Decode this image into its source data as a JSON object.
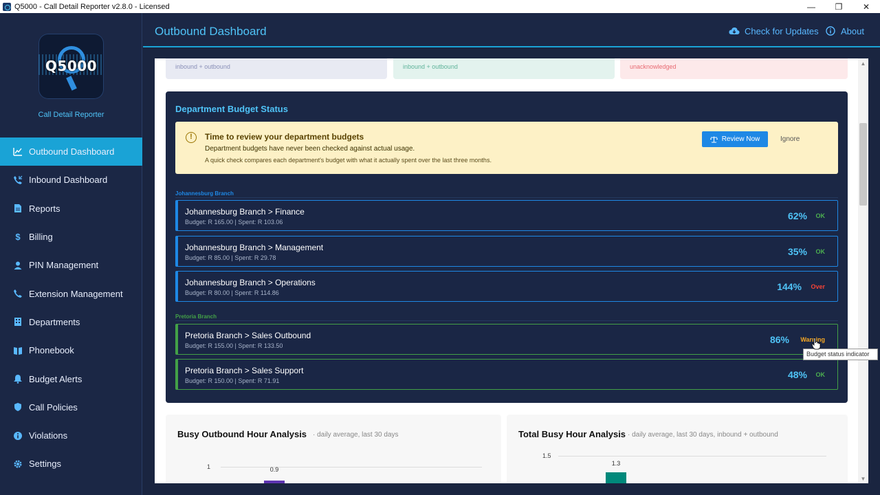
{
  "window": {
    "title": "Q5000 - Call Detail Reporter v2.8.0 - Licensed",
    "minimize": "—",
    "maximize": "❐",
    "close": "✕"
  },
  "sidebar": {
    "logo_text": "Q5000",
    "subtitle": "Call Detail Reporter",
    "items": [
      {
        "label": "Outbound Dashboard",
        "icon": "chart-line-icon",
        "active": true
      },
      {
        "label": "Inbound Dashboard",
        "icon": "phone-incoming-icon"
      },
      {
        "label": "Reports",
        "icon": "document-icon"
      },
      {
        "label": "Billing",
        "icon": "dollar-icon"
      },
      {
        "label": "PIN Management",
        "icon": "user-icon"
      },
      {
        "label": "Extension Management",
        "icon": "phone-icon"
      },
      {
        "label": "Departments",
        "icon": "building-icon"
      },
      {
        "label": "Phonebook",
        "icon": "book-icon"
      },
      {
        "label": "Budget Alerts",
        "icon": "bell-icon"
      },
      {
        "label": "Call Policies",
        "icon": "shield-icon"
      },
      {
        "label": "Violations",
        "icon": "info-icon"
      },
      {
        "label": "Settings",
        "icon": "gear-icon"
      }
    ]
  },
  "header": {
    "title": "Outbound Dashboard",
    "check_updates": "Check for Updates",
    "about": "About"
  },
  "stat_cards": [
    {
      "sub": "inbound + outbound"
    },
    {
      "sub": "inbound + outbound"
    },
    {
      "sub": "unacknowledged"
    }
  ],
  "budget": {
    "title": "Department Budget Status",
    "alert": {
      "title": "Time to review your department budgets",
      "line1": "Department budgets have never been checked against actual usage.",
      "line2": "A quick check compares each department's budget with what it actually spent over the last three months.",
      "review_button": "Review Now",
      "ignore_button": "Ignore"
    },
    "branches": [
      {
        "name": "Johannesburg Branch",
        "departments": [
          {
            "name": "Johannesburg Branch > Finance",
            "detail": "Budget:  R 165.00  | Spent:  R 103.06",
            "pct": "62%",
            "status": "OK"
          },
          {
            "name": "Johannesburg Branch > Management",
            "detail": "Budget:  R 85.00  | Spent:  R 29.78",
            "pct": "35%",
            "status": "OK"
          },
          {
            "name": "Johannesburg Branch > Operations",
            "detail": "Budget:  R 80.00  | Spent:  R 114.86",
            "pct": "144%",
            "status": "Over"
          }
        ]
      },
      {
        "name": "Pretoria Branch",
        "departments": [
          {
            "name": "Pretoria Branch > Sales Outbound",
            "detail": "Budget:  R 155.00  | Spent:  R 133.50",
            "pct": "86%",
            "status": "Warning"
          },
          {
            "name": "Pretoria Branch > Sales Support",
            "detail": "Budget:  R 150.00  | Spent:  R 71.91",
            "pct": "48%",
            "status": "OK"
          }
        ]
      }
    ],
    "tooltip": "Budget status indicator"
  },
  "colors": {
    "accent": "#4fc3f7",
    "ok": "#4caf50",
    "over": "#f44336",
    "warning": "#f5a623",
    "joburg_branch": "#1e88e5",
    "pretoria_branch": "#43a047"
  },
  "charts": {
    "busy_outbound": {
      "title": "Busy Outbound Hour Analysis",
      "subtitle": "· daily average, last 30 days"
    },
    "total_busy": {
      "title": "Total Busy Hour Analysis",
      "subtitle": "· daily average, last 30 days, inbound + outbound"
    }
  },
  "chart_data": [
    {
      "type": "bar",
      "title": "Busy Outbound Hour Analysis",
      "y_tick_labels": [
        "1"
      ],
      "values": [
        0.9
      ],
      "data_labels": [
        "0.9"
      ],
      "color": "#5e35b1"
    },
    {
      "type": "bar",
      "title": "Total Busy Hour Analysis",
      "y_tick_labels": [
        "1.5"
      ],
      "values": [
        1.3
      ],
      "data_labels": [
        "1.3"
      ],
      "color": "#00897b"
    }
  ]
}
